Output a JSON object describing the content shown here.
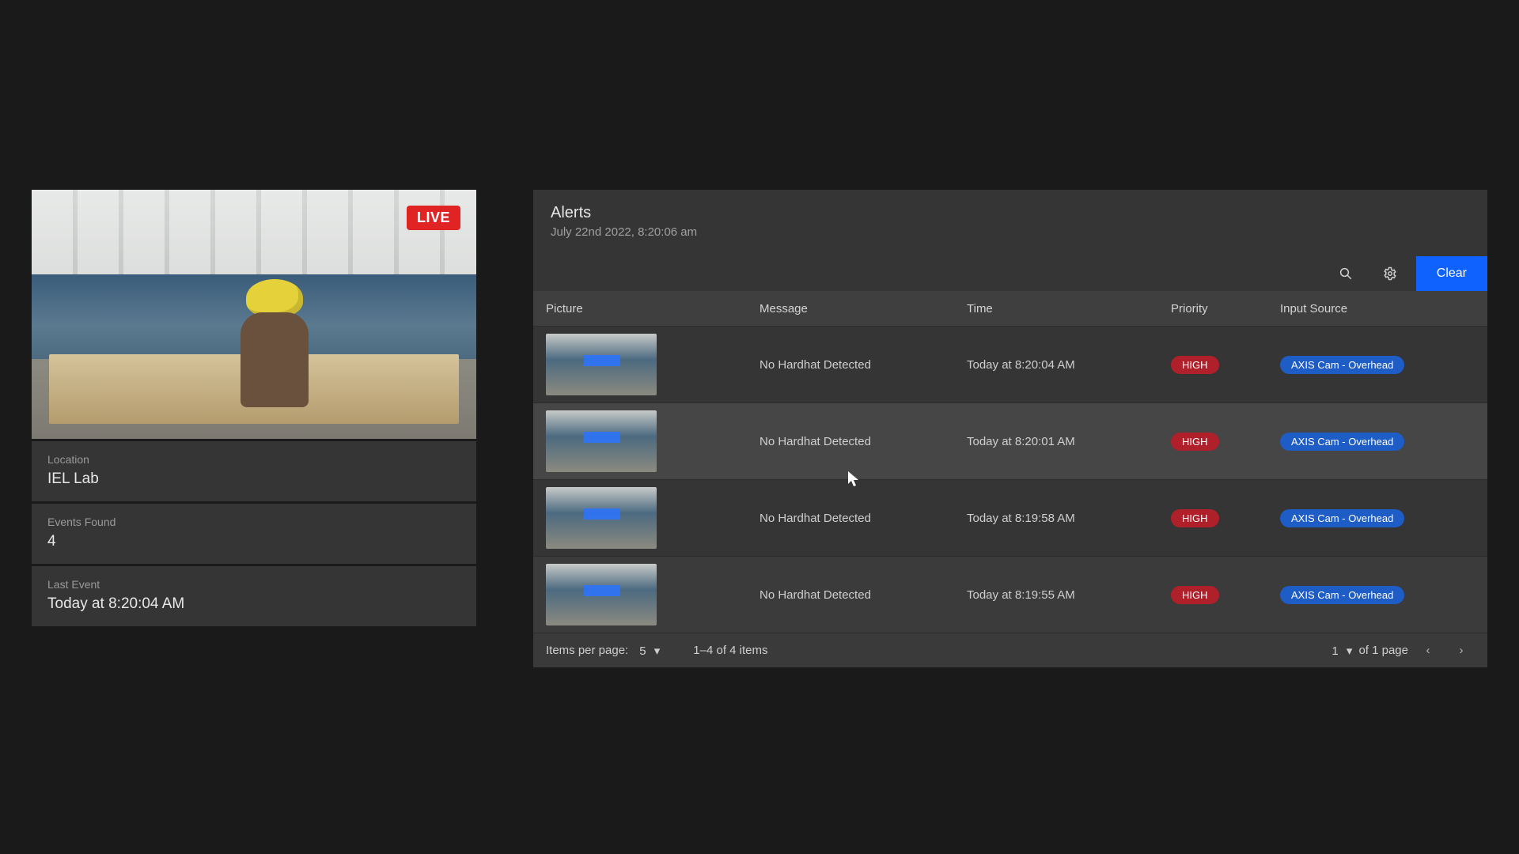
{
  "left": {
    "live_label": "LIVE",
    "cards": [
      {
        "label": "Location",
        "value": "IEL Lab"
      },
      {
        "label": "Events Found",
        "value": "4"
      },
      {
        "label": "Last Event",
        "value": "Today at 8:20:04 AM"
      }
    ]
  },
  "alerts": {
    "title": "Alerts",
    "timestamp": "July 22nd 2022, 8:20:06 am",
    "toolbar": {
      "clear_label": "Clear"
    },
    "headers": {
      "picture": "Picture",
      "message": "Message",
      "time": "Time",
      "priority": "Priority",
      "source": "Input Source"
    },
    "rows": [
      {
        "message": "No Hardhat Detected",
        "time": "Today at 8:20:04 AM",
        "priority": "HIGH",
        "source": "AXIS Cam - Overhead"
      },
      {
        "message": "No Hardhat Detected",
        "time": "Today at 8:20:01 AM",
        "priority": "HIGH",
        "source": "AXIS Cam - Overhead"
      },
      {
        "message": "No Hardhat Detected",
        "time": "Today at 8:19:58 AM",
        "priority": "HIGH",
        "source": "AXIS Cam - Overhead"
      },
      {
        "message": "No Hardhat Detected",
        "time": "Today at 8:19:55 AM",
        "priority": "HIGH",
        "source": "AXIS Cam - Overhead"
      }
    ],
    "pager": {
      "ipp_label": "Items per page:",
      "ipp_value": "5",
      "range": "1–4 of 4 items",
      "page_value": "1",
      "page_total": "of 1 page"
    }
  }
}
